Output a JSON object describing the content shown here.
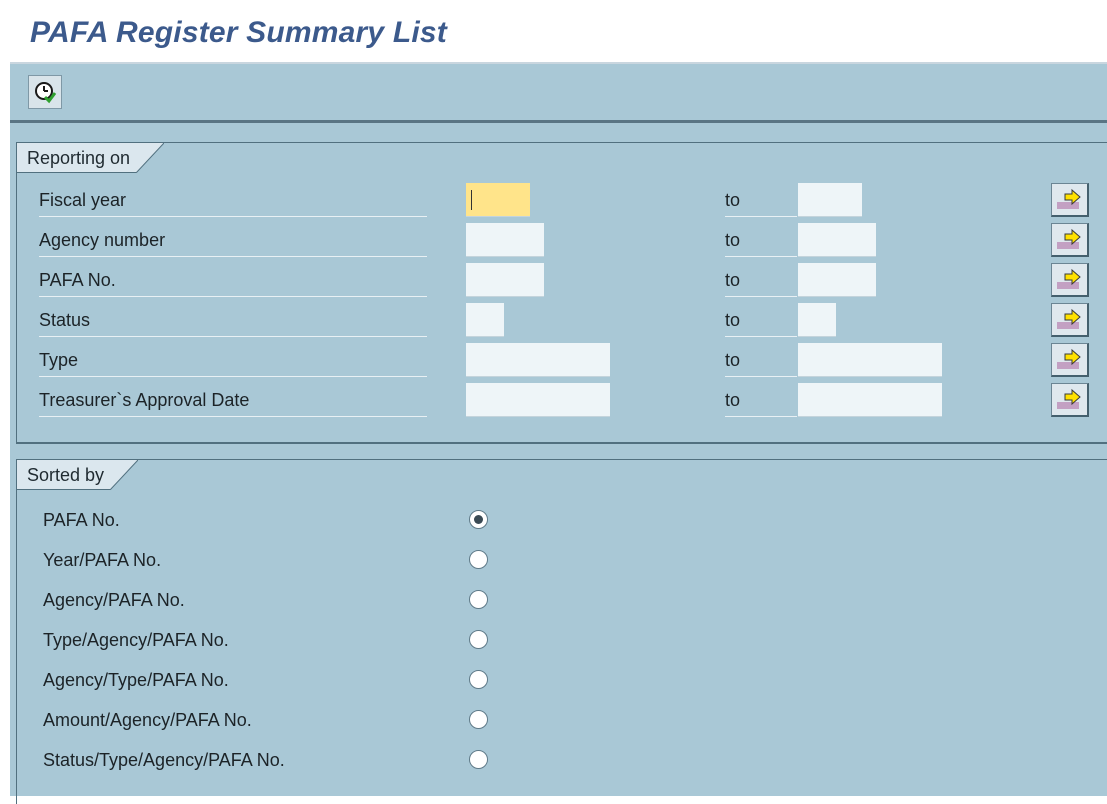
{
  "title": "PAFA Register Summary List",
  "toolbar": {
    "execute_icon": "execute-clock-icon"
  },
  "reporting": {
    "header": "Reporting on",
    "to_label": "to",
    "rows": [
      {
        "label": "Fiscal year",
        "from": "",
        "to": ""
      },
      {
        "label": "Agency number",
        "from": "",
        "to": ""
      },
      {
        "label": "PAFA No.",
        "from": "",
        "to": ""
      },
      {
        "label": "Status",
        "from": "",
        "to": ""
      },
      {
        "label": "Type",
        "from": "",
        "to": ""
      },
      {
        "label": "Treasurer`s Approval Date",
        "from": "",
        "to": ""
      }
    ]
  },
  "sorted": {
    "header": "Sorted by",
    "options": [
      {
        "label": "PAFA No.",
        "checked": true
      },
      {
        "label": "Year/PAFA No.",
        "checked": false
      },
      {
        "label": "Agency/PAFA No.",
        "checked": false
      },
      {
        "label": "Type/Agency/PAFA No.",
        "checked": false
      },
      {
        "label": "Agency/Type/PAFA No.",
        "checked": false
      },
      {
        "label": "Amount/Agency/PAFA No.",
        "checked": false
      },
      {
        "label": "Status/Type/Agency/PAFA No.",
        "checked": false
      }
    ]
  },
  "colors": {
    "background": "#a9c8d6",
    "title": "#3c5a8c",
    "focus": "#ffe48a"
  }
}
